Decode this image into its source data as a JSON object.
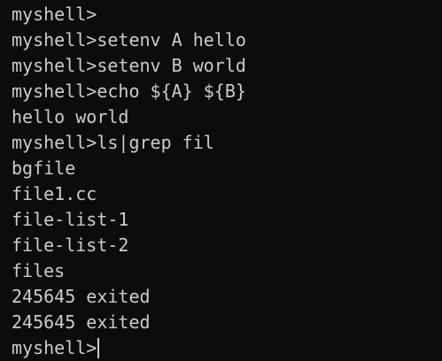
{
  "terminal": {
    "lines": [
      "myshell>",
      "myshell>setenv A hello",
      "myshell>setenv B world",
      "myshell>echo ${A} ${B}",
      "hello world",
      "myshell>ls|grep fil",
      "bgfile",
      "file1.cc",
      "file-list-1",
      "file-list-2",
      "files",
      "245645 exited",
      "245645 exited"
    ],
    "prompt": "myshell>"
  },
  "colors": {
    "background": "#0c0c0c",
    "foreground": "#cccccc"
  }
}
